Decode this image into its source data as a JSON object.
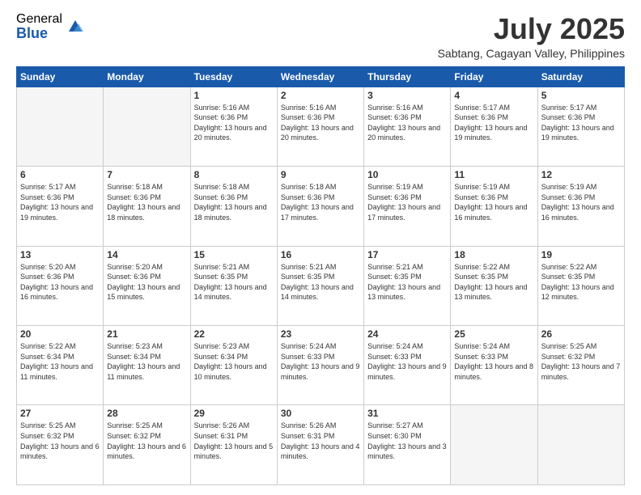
{
  "logo": {
    "general": "General",
    "blue": "Blue"
  },
  "title": "July 2025",
  "subtitle": "Sabtang, Cagayan Valley, Philippines",
  "weekdays": [
    "Sunday",
    "Monday",
    "Tuesday",
    "Wednesday",
    "Thursday",
    "Friday",
    "Saturday"
  ],
  "weeks": [
    [
      {
        "day": "",
        "info": ""
      },
      {
        "day": "",
        "info": ""
      },
      {
        "day": "1",
        "info": "Sunrise: 5:16 AM\nSunset: 6:36 PM\nDaylight: 13 hours and 20 minutes."
      },
      {
        "day": "2",
        "info": "Sunrise: 5:16 AM\nSunset: 6:36 PM\nDaylight: 13 hours and 20 minutes."
      },
      {
        "day": "3",
        "info": "Sunrise: 5:16 AM\nSunset: 6:36 PM\nDaylight: 13 hours and 20 minutes."
      },
      {
        "day": "4",
        "info": "Sunrise: 5:17 AM\nSunset: 6:36 PM\nDaylight: 13 hours and 19 minutes."
      },
      {
        "day": "5",
        "info": "Sunrise: 5:17 AM\nSunset: 6:36 PM\nDaylight: 13 hours and 19 minutes."
      }
    ],
    [
      {
        "day": "6",
        "info": "Sunrise: 5:17 AM\nSunset: 6:36 PM\nDaylight: 13 hours and 19 minutes."
      },
      {
        "day": "7",
        "info": "Sunrise: 5:18 AM\nSunset: 6:36 PM\nDaylight: 13 hours and 18 minutes."
      },
      {
        "day": "8",
        "info": "Sunrise: 5:18 AM\nSunset: 6:36 PM\nDaylight: 13 hours and 18 minutes."
      },
      {
        "day": "9",
        "info": "Sunrise: 5:18 AM\nSunset: 6:36 PM\nDaylight: 13 hours and 17 minutes."
      },
      {
        "day": "10",
        "info": "Sunrise: 5:19 AM\nSunset: 6:36 PM\nDaylight: 13 hours and 17 minutes."
      },
      {
        "day": "11",
        "info": "Sunrise: 5:19 AM\nSunset: 6:36 PM\nDaylight: 13 hours and 16 minutes."
      },
      {
        "day": "12",
        "info": "Sunrise: 5:19 AM\nSunset: 6:36 PM\nDaylight: 13 hours and 16 minutes."
      }
    ],
    [
      {
        "day": "13",
        "info": "Sunrise: 5:20 AM\nSunset: 6:36 PM\nDaylight: 13 hours and 16 minutes."
      },
      {
        "day": "14",
        "info": "Sunrise: 5:20 AM\nSunset: 6:36 PM\nDaylight: 13 hours and 15 minutes."
      },
      {
        "day": "15",
        "info": "Sunrise: 5:21 AM\nSunset: 6:35 PM\nDaylight: 13 hours and 14 minutes."
      },
      {
        "day": "16",
        "info": "Sunrise: 5:21 AM\nSunset: 6:35 PM\nDaylight: 13 hours and 14 minutes."
      },
      {
        "day": "17",
        "info": "Sunrise: 5:21 AM\nSunset: 6:35 PM\nDaylight: 13 hours and 13 minutes."
      },
      {
        "day": "18",
        "info": "Sunrise: 5:22 AM\nSunset: 6:35 PM\nDaylight: 13 hours and 13 minutes."
      },
      {
        "day": "19",
        "info": "Sunrise: 5:22 AM\nSunset: 6:35 PM\nDaylight: 13 hours and 12 minutes."
      }
    ],
    [
      {
        "day": "20",
        "info": "Sunrise: 5:22 AM\nSunset: 6:34 PM\nDaylight: 13 hours and 11 minutes."
      },
      {
        "day": "21",
        "info": "Sunrise: 5:23 AM\nSunset: 6:34 PM\nDaylight: 13 hours and 11 minutes."
      },
      {
        "day": "22",
        "info": "Sunrise: 5:23 AM\nSunset: 6:34 PM\nDaylight: 13 hours and 10 minutes."
      },
      {
        "day": "23",
        "info": "Sunrise: 5:24 AM\nSunset: 6:33 PM\nDaylight: 13 hours and 9 minutes."
      },
      {
        "day": "24",
        "info": "Sunrise: 5:24 AM\nSunset: 6:33 PM\nDaylight: 13 hours and 9 minutes."
      },
      {
        "day": "25",
        "info": "Sunrise: 5:24 AM\nSunset: 6:33 PM\nDaylight: 13 hours and 8 minutes."
      },
      {
        "day": "26",
        "info": "Sunrise: 5:25 AM\nSunset: 6:32 PM\nDaylight: 13 hours and 7 minutes."
      }
    ],
    [
      {
        "day": "27",
        "info": "Sunrise: 5:25 AM\nSunset: 6:32 PM\nDaylight: 13 hours and 6 minutes."
      },
      {
        "day": "28",
        "info": "Sunrise: 5:25 AM\nSunset: 6:32 PM\nDaylight: 13 hours and 6 minutes."
      },
      {
        "day": "29",
        "info": "Sunrise: 5:26 AM\nSunset: 6:31 PM\nDaylight: 13 hours and 5 minutes."
      },
      {
        "day": "30",
        "info": "Sunrise: 5:26 AM\nSunset: 6:31 PM\nDaylight: 13 hours and 4 minutes."
      },
      {
        "day": "31",
        "info": "Sunrise: 5:27 AM\nSunset: 6:30 PM\nDaylight: 13 hours and 3 minutes."
      },
      {
        "day": "",
        "info": ""
      },
      {
        "day": "",
        "info": ""
      }
    ]
  ]
}
